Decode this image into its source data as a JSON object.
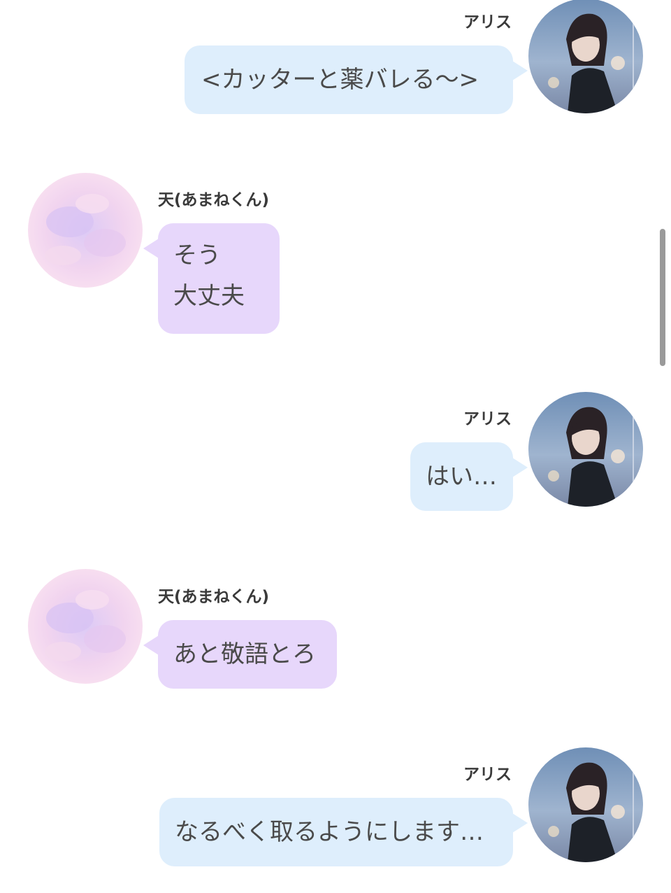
{
  "participants": {
    "alice": {
      "name": "アリス",
      "avatar_icon": "girl-portrait-avatar-icon",
      "bubble_color": "#deeefc"
    },
    "ten": {
      "name": "天(あまねくん)",
      "avatar_icon": "pastel-cloud-avatar-icon",
      "bubble_color": "#e7d7fb"
    }
  },
  "messages": [
    {
      "sender": "アリス",
      "lines": [
        "<カッターと薬バレる〜>"
      ]
    },
    {
      "sender": "天(あまねくん)",
      "lines": [
        "そう",
        "大丈夫"
      ]
    },
    {
      "sender": "アリス",
      "lines": [
        "はい…"
      ]
    },
    {
      "sender": "天(あまねくん)",
      "lines": [
        "あと敬語とろ"
      ]
    },
    {
      "sender": "アリス",
      "lines": [
        "なるべく取るようにします…"
      ]
    }
  ]
}
